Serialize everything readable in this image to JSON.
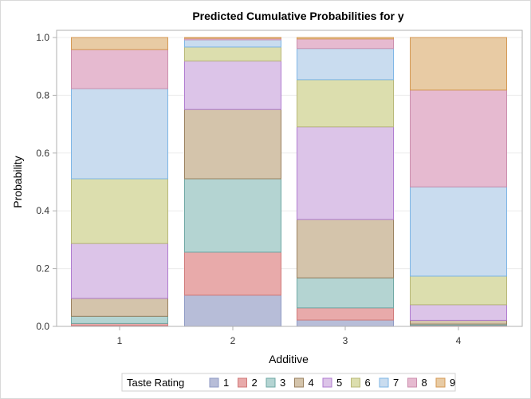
{
  "chart_data": {
    "type": "bar",
    "stacked": true,
    "title": "Predicted Cumulative Probabilities for y",
    "xlabel": "Additive",
    "ylabel": "Probability",
    "categories": [
      "1",
      "2",
      "3",
      "4"
    ],
    "ylim": [
      0,
      1
    ],
    "yticks": [
      "0.0",
      "0.2",
      "0.4",
      "0.6",
      "0.8",
      "1.0"
    ],
    "ytick_values": [
      0,
      0.2,
      0.4,
      0.6,
      0.8,
      1.0
    ],
    "grid": true,
    "legend": {
      "title": "Taste Rating",
      "placement": "bottom"
    },
    "series": [
      {
        "name": "1",
        "fill": "#b7bdd8",
        "stroke": "#8f9ac4",
        "values": [
          0.003,
          0.108,
          0.022,
          0.001
        ]
      },
      {
        "name": "2",
        "fill": "#e8aaaa",
        "stroke": "#d07a7a",
        "values": [
          0.007,
          0.149,
          0.042,
          0.003
        ]
      },
      {
        "name": "3",
        "fill": "#b4d4d2",
        "stroke": "#6fa8a4",
        "values": [
          0.025,
          0.254,
          0.104,
          0.004
        ]
      },
      {
        "name": "4",
        "fill": "#d4c4ab",
        "stroke": "#9a8160",
        "values": [
          0.062,
          0.24,
          0.202,
          0.013
        ]
      },
      {
        "name": "5",
        "fill": "#dcc4e8",
        "stroke": "#b07cd0",
        "values": [
          0.19,
          0.168,
          0.321,
          0.054
        ]
      },
      {
        "name": "6",
        "fill": "#dcdeae",
        "stroke": "#b8b878",
        "values": [
          0.224,
          0.048,
          0.163,
          0.099
        ]
      },
      {
        "name": "7",
        "fill": "#c9dcef",
        "stroke": "#7eb6e6",
        "values": [
          0.312,
          0.025,
          0.108,
          0.309
        ]
      },
      {
        "name": "8",
        "fill": "#e6bad0",
        "stroke": "#cc8fae",
        "values": [
          0.135,
          0.005,
          0.033,
          0.335
        ]
      },
      {
        "name": "9",
        "fill": "#e8cba4",
        "stroke": "#d59a55",
        "values": [
          0.042,
          0.003,
          0.005,
          0.182
        ]
      }
    ]
  }
}
